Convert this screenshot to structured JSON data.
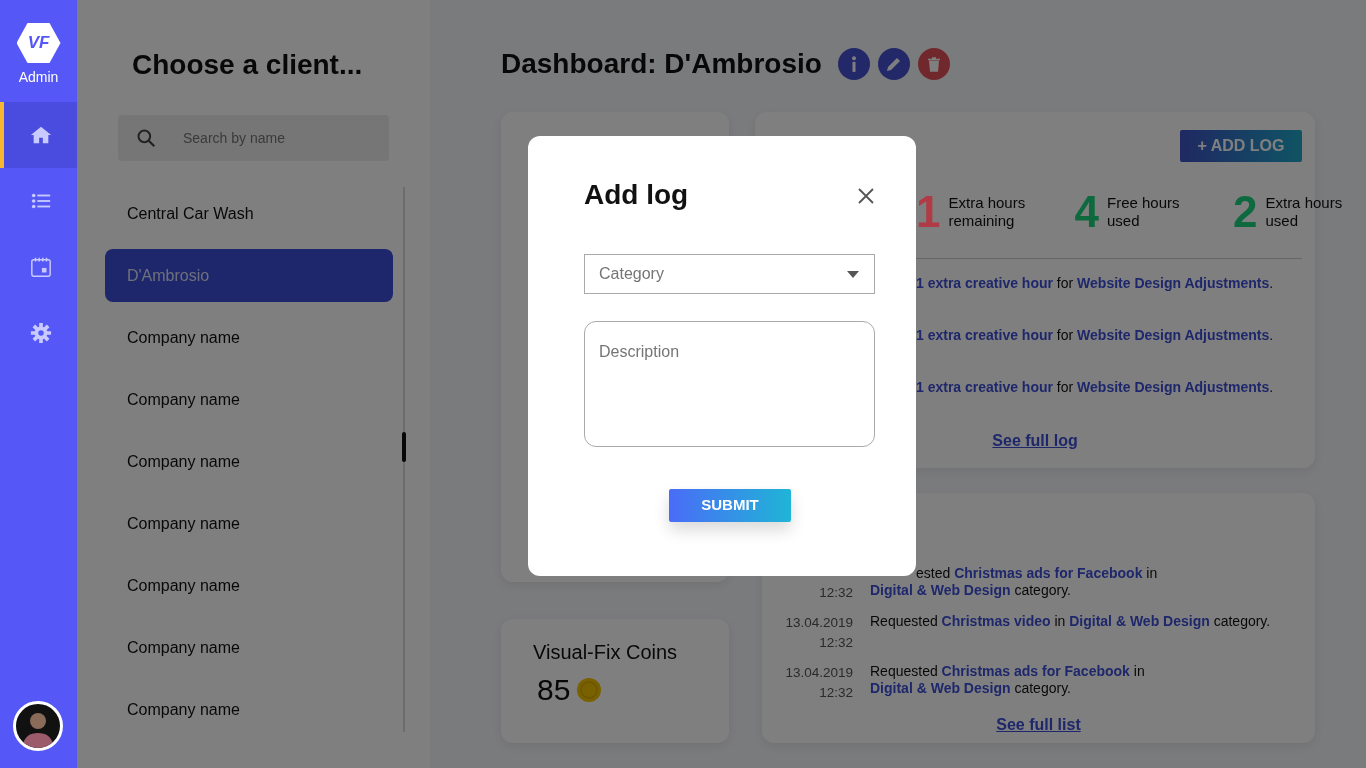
{
  "sidebar": {
    "logo": "VF",
    "brand": "Admin",
    "nav": [
      {
        "kind": "home",
        "selected": true
      },
      {
        "kind": "list",
        "selected": false
      },
      {
        "kind": "calendar",
        "selected": false
      },
      {
        "kind": "settings",
        "selected": false
      }
    ]
  },
  "clients": {
    "title": "Choose a client...",
    "search": {
      "placeholder": "Search by name"
    },
    "items": [
      {
        "name": "Central Car Wash",
        "selected": false
      },
      {
        "name": "D'Ambrosio",
        "selected": true
      },
      {
        "name": "Company name",
        "selected": false
      },
      {
        "name": "Company name",
        "selected": false
      },
      {
        "name": "Company name",
        "selected": false
      },
      {
        "name": "Company name",
        "selected": false
      },
      {
        "name": "Company name",
        "selected": false
      },
      {
        "name": "Company name",
        "selected": false
      },
      {
        "name": "Company name",
        "selected": false
      }
    ]
  },
  "dashboard": {
    "title": "Dashboard: D'Ambrosio",
    "actions": [
      {
        "kind": "info"
      },
      {
        "kind": "edit"
      },
      {
        "kind": "delete"
      }
    ]
  },
  "coins": {
    "label": "Visual-Fix Coins",
    "value": "85"
  },
  "activity_log": {
    "add_button": "+ ADD LOG",
    "stats": [
      {
        "value": "1",
        "label": "Extra hours remaining",
        "color": "#b03a45"
      },
      {
        "value": "4",
        "label": "Free hours used",
        "color": "#0e6a3e"
      },
      {
        "value": "2",
        "label": "Extra hours used",
        "color": "#0e6a3e"
      }
    ],
    "entries": [
      {
        "parts": [
          {
            "text": "1 extra creative hour",
            "link": true
          },
          {
            "text": " for ",
            "link": false
          },
          {
            "text": "Website Design Adjustments",
            "link": true
          },
          {
            "text": ".",
            "link": false
          }
        ]
      },
      {
        "parts": [
          {
            "text": "1 extra creative hour",
            "link": true
          },
          {
            "text": " for ",
            "link": false
          },
          {
            "text": "Website Design Adjustments",
            "link": true
          },
          {
            "text": ".",
            "link": false
          }
        ]
      },
      {
        "parts": [
          {
            "text": "1 extra creative hour",
            "link": true
          },
          {
            "text": " for ",
            "link": false
          },
          {
            "text": "Website Design Adjustments",
            "link": true
          },
          {
            "text": ".",
            "link": false
          }
        ]
      }
    ],
    "link": "See full log"
  },
  "requests": {
    "entries": [
      {
        "time": "12:32",
        "parts": [
          {
            "text": "ested ",
            "link": false
          },
          {
            "text": "Christmas ads for Facebook",
            "link": true
          },
          {
            "text": " in ",
            "link": false
          },
          {
            "text": "Digital & Web Design",
            "link": true
          },
          {
            "text": " category.",
            "link": false
          }
        ]
      },
      {
        "date": "13.04.2019",
        "time": "12:32",
        "parts": [
          {
            "text": "Requested ",
            "link": false
          },
          {
            "text": "Christmas video",
            "link": true
          },
          {
            "text": " in ",
            "link": false
          },
          {
            "text": "Digital & Web Design",
            "link": true
          },
          {
            "text": " category.",
            "link": false
          }
        ]
      },
      {
        "date": "13.04.2019",
        "time": "12:32",
        "parts": [
          {
            "text": "Requested ",
            "link": false
          },
          {
            "text": "Christmas ads for Facebook",
            "link": true
          },
          {
            "text": " in ",
            "link": false
          },
          {
            "text": "Digital & Web Design",
            "link": true
          },
          {
            "text": " category.",
            "link": false
          }
        ]
      }
    ],
    "link": "See full list"
  },
  "modal": {
    "title": "Add log",
    "category": {
      "placeholder": "Category"
    },
    "description": {
      "placeholder": "Description"
    },
    "submit": "SUBMIT"
  }
}
